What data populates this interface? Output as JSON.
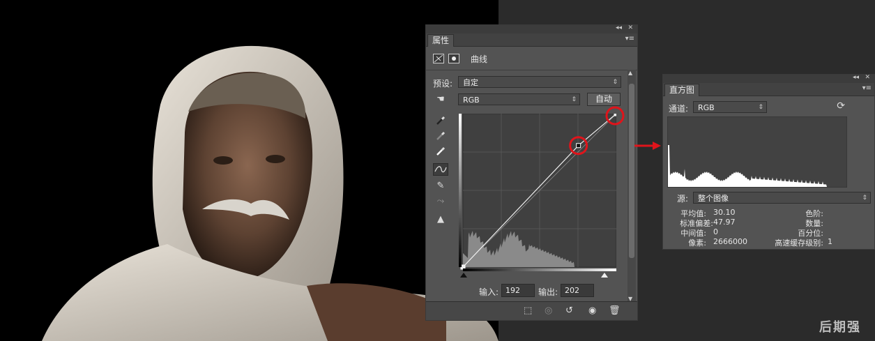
{
  "properties_panel": {
    "tab_label": "属性",
    "collapse_glyph": "◂◂",
    "close_glyph": "✕",
    "menu_glyph": "▾≡",
    "adjustment_title": "曲线",
    "preset_label": "预设:",
    "preset_value": "自定",
    "channel_value": "RGB",
    "auto_button": "自动",
    "input_label": "输入:",
    "input_value": "192",
    "output_label": "输出:",
    "output_value": "202",
    "tools": [
      "sample-in-image-icon",
      "black-point-eyedropper-icon",
      "gray-point-eyedropper-icon",
      "white-point-eyedropper-icon",
      "curve-edit-points-icon",
      "pencil-draw-icon",
      "smooth-curve-icon",
      "clipping-warning-icon"
    ],
    "footer_icons": [
      "clip-to-layer-icon",
      "view-previous-state-icon",
      "reset-icon",
      "visibility-eye-icon",
      "delete-icon"
    ]
  },
  "histogram_panel": {
    "tab_label": "直方图",
    "collapse_glyph": "◂◂",
    "close_glyph": "✕",
    "menu_glyph": "▾≡",
    "channel_label": "通道:",
    "channel_value": "RGB",
    "source_label": "源:",
    "source_value": "整个图像",
    "stats": {
      "mean_label": "平均值:",
      "mean_value": "30.10",
      "stddev_label": "标准偏差:",
      "stddev_value": "47.97",
      "median_label": "中间值:",
      "median_value": "0",
      "pixels_label": "像素:",
      "pixels_value": "2666000",
      "level_label": "色阶:",
      "count_label": "数量:",
      "percentile_label": "百分位:",
      "cache_level_label": "高速缓存级别:",
      "cache_level_value": "1"
    }
  },
  "curve": {
    "points": [
      [
        0,
        0
      ],
      [
        192,
        202
      ],
      [
        255,
        255
      ]
    ]
  },
  "watermark": "后期强",
  "colors": {
    "panel_bg": "#535353",
    "highlight_circle": "#e0141b",
    "arrow": "#e0141b"
  }
}
